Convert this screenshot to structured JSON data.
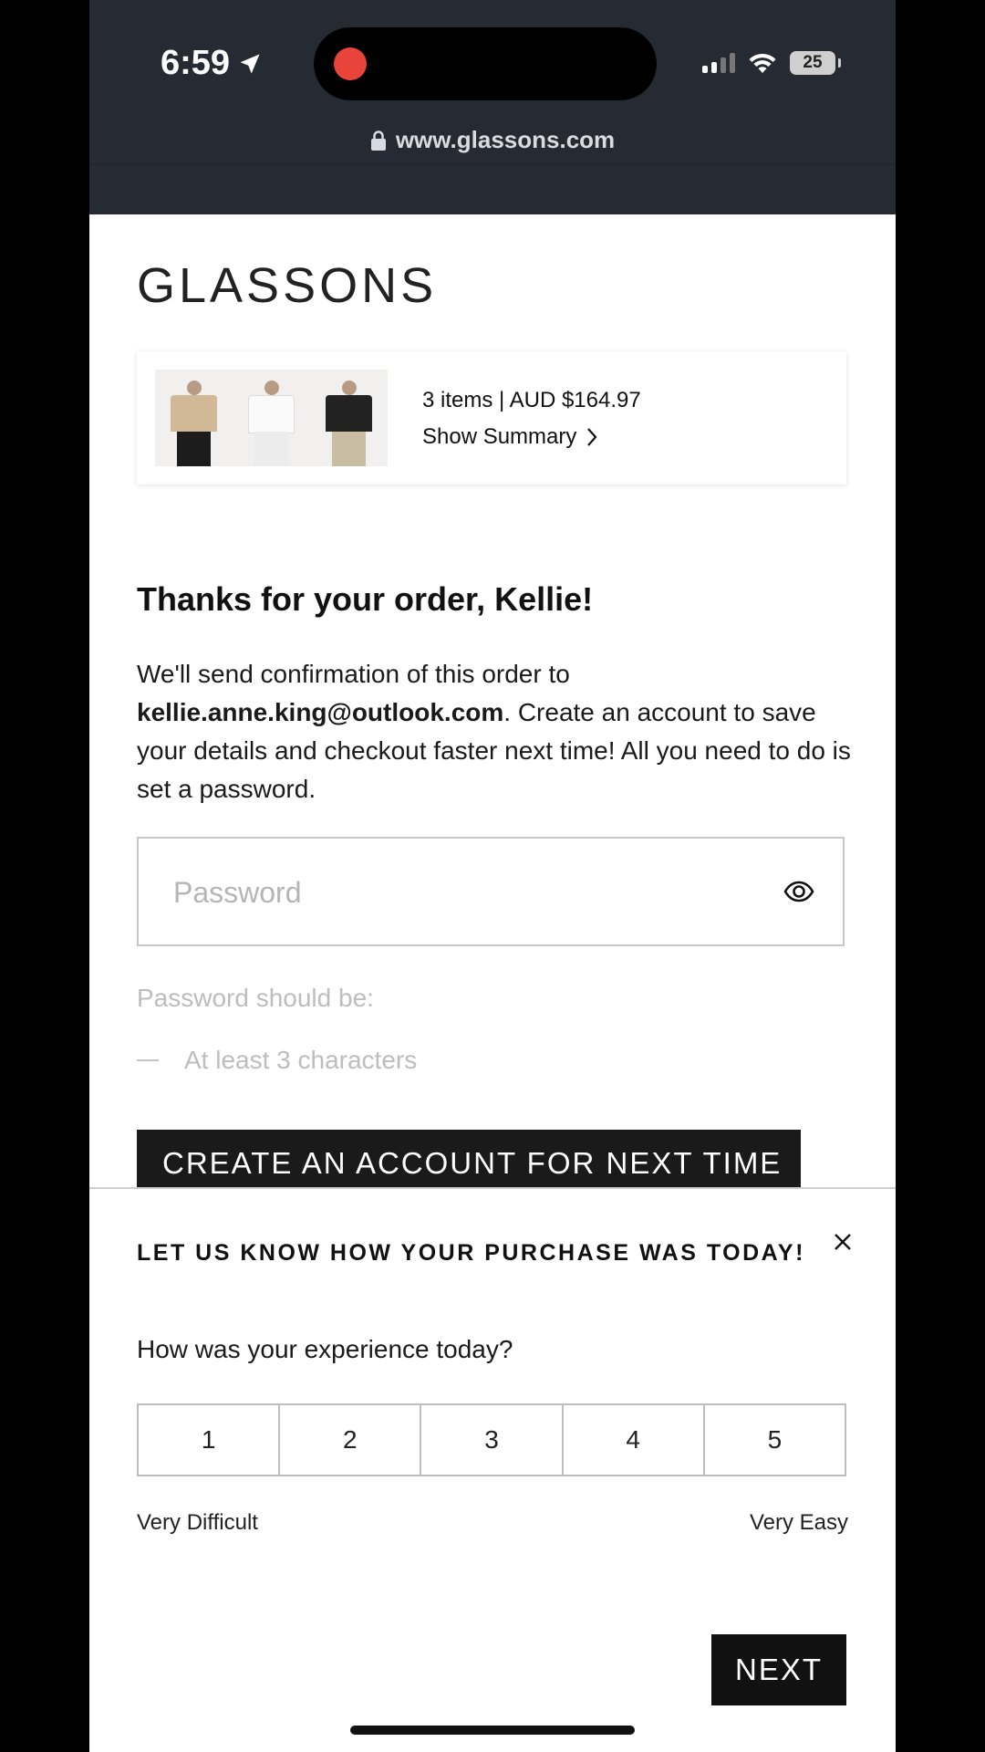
{
  "status_bar": {
    "time": "6:59",
    "battery": "25"
  },
  "browser": {
    "url": "www.glassons.com"
  },
  "brand": {
    "logo": "GLASSONS"
  },
  "order_summary": {
    "items_price": "3 items | AUD $164.97",
    "show_summary": "Show Summary"
  },
  "confirmation": {
    "heading": "Thanks for your order, Kellie!",
    "text_before": "We'll send confirmation of this order to ",
    "email": "kellie.anne.king@outlook.com",
    "text_after": ". Create an account to save your details and checkout faster next time! All you need to do is set a password."
  },
  "password": {
    "placeholder": "Password",
    "rules_title": "Password should be:",
    "rules": [
      "At least 3 characters"
    ]
  },
  "create_account": {
    "label": "CREATE AN ACCOUNT FOR NEXT TIME"
  },
  "feedback": {
    "title": "LET US KNOW HOW YOUR PURCHASE WAS TODAY!",
    "question": "How was your experience today?",
    "options": [
      "1",
      "2",
      "3",
      "4",
      "5"
    ],
    "low_label": "Very Difficult",
    "high_label": "Very Easy",
    "next_label": "NEXT"
  },
  "colors": {
    "top_bar": "#262a33",
    "button": "#1a1a1a",
    "recording": "#e8443a"
  },
  "icons": [
    "location-arrow-icon",
    "signal-icon",
    "wifi-icon",
    "battery-icon",
    "lock-icon",
    "chevron-right-icon",
    "eye-icon",
    "close-icon"
  ]
}
